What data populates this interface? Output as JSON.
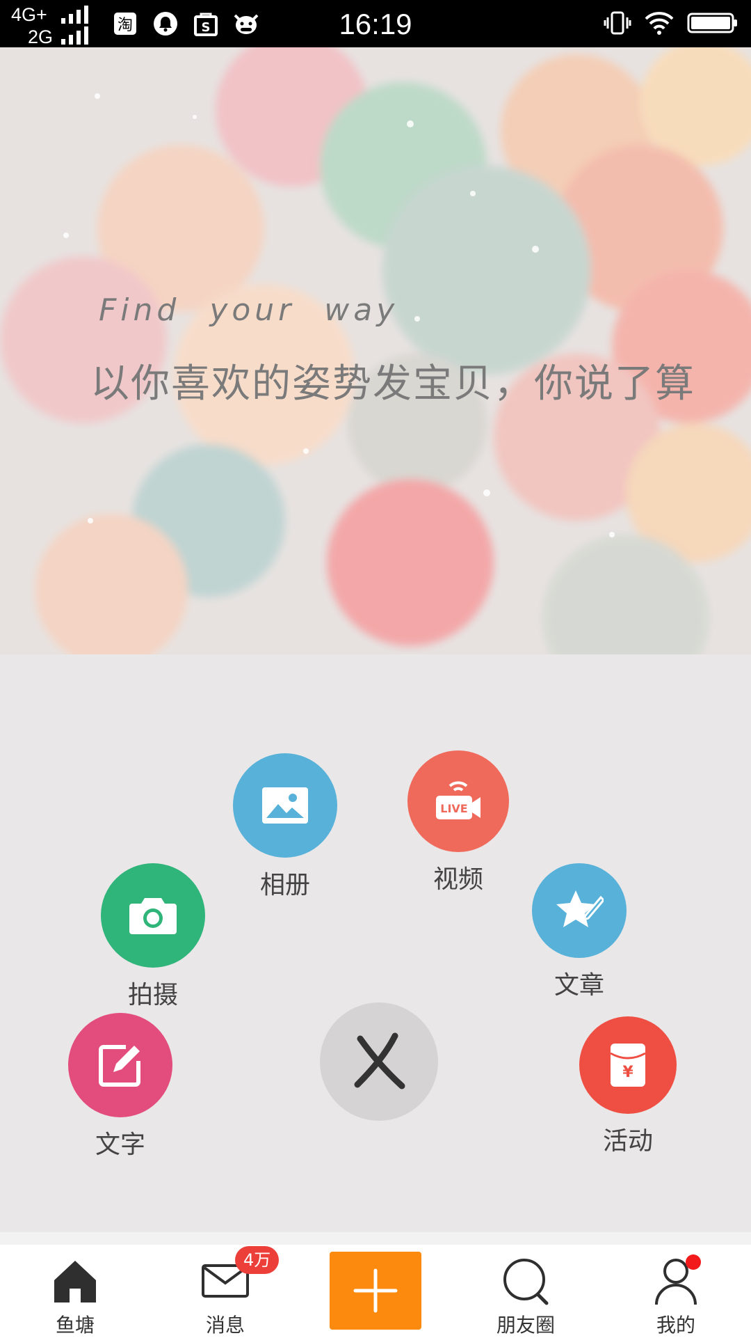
{
  "status_bar": {
    "network_primary": "4G+",
    "network_secondary": "2G",
    "time": "16:19",
    "notification_icons": [
      "taobao-icon",
      "bell-icon",
      "shopping-bag-icon",
      "cow-icon"
    ],
    "right_icons": [
      "vibrate-icon",
      "wifi-icon",
      "battery-icon"
    ]
  },
  "banner": {
    "tagline_en": "Find your way",
    "tagline_zh": "以你喜欢的姿势发宝贝，你说了算"
  },
  "publish_menu": {
    "items": [
      {
        "label": "相册",
        "icon": "image-icon",
        "color": "#57b1d8"
      },
      {
        "label": "视频",
        "icon": "live-video-icon",
        "color": "#f06a5c"
      },
      {
        "label": "拍摄",
        "icon": "camera-icon",
        "color": "#2fb479"
      },
      {
        "label": "文章",
        "icon": "star-pen-icon",
        "color": "#57b1d8"
      },
      {
        "label": "文字",
        "icon": "edit-icon",
        "color": "#e34d7d"
      },
      {
        "label": "活动",
        "icon": "red-packet-icon",
        "color": "#ef4f43"
      }
    ],
    "close_icon": "close-icon"
  },
  "bottom_nav": {
    "items": [
      {
        "label": "鱼塘",
        "icon": "home-icon"
      },
      {
        "label": "消息",
        "icon": "mail-icon",
        "badge": "4万"
      },
      {
        "label": "",
        "icon": "plus-icon"
      },
      {
        "label": "朋友圈",
        "icon": "search-icon"
      },
      {
        "label": "我的",
        "icon": "user-icon"
      }
    ],
    "accent_color": "#fb8a0e"
  }
}
